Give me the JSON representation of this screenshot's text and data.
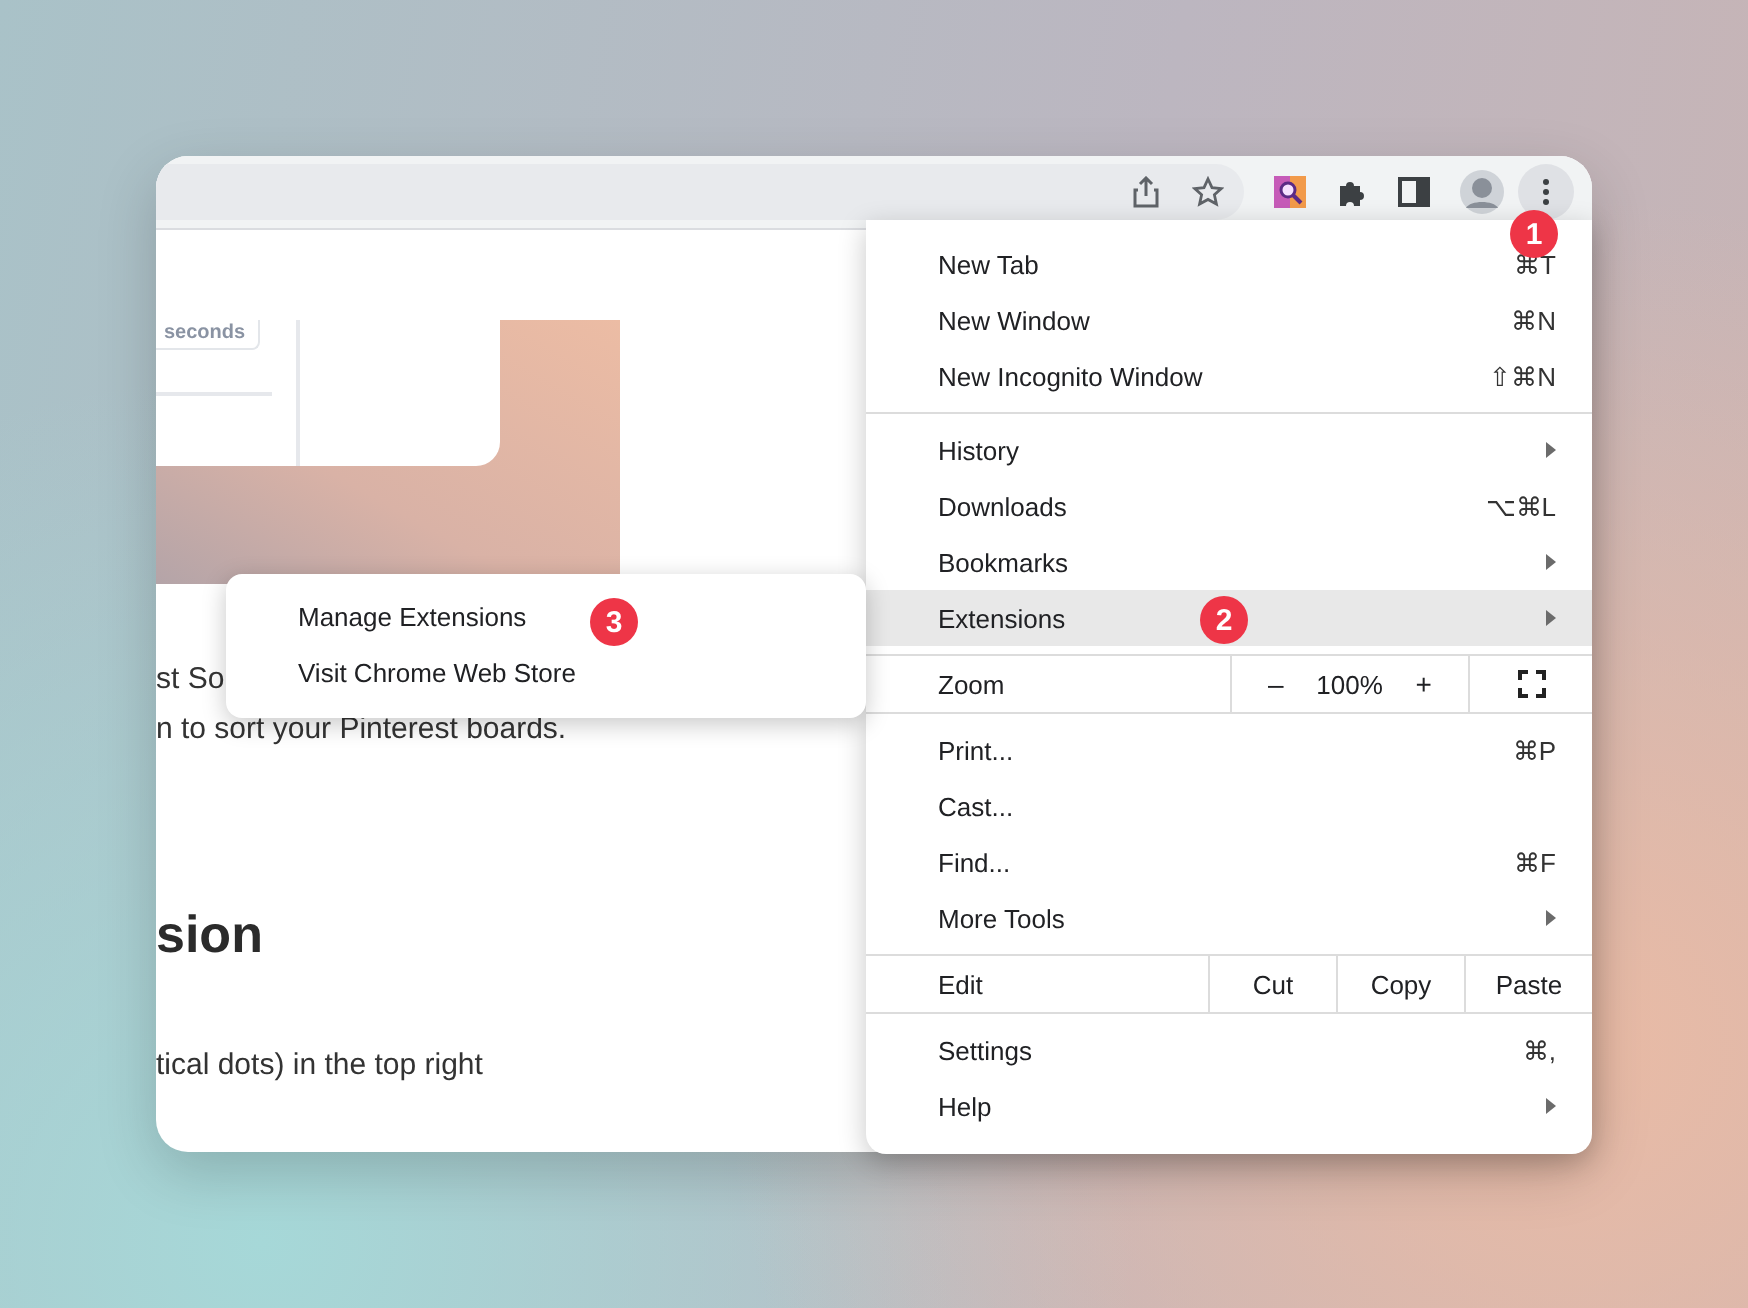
{
  "page": {
    "image": {
      "kind": "picture",
      "chip": "seconds"
    },
    "lines": [
      "st So",
      "n to sort your Pinterest boards."
    ],
    "heading": "sion",
    "text": "tical dots) in the top right"
  },
  "menu": {
    "sections": [
      {
        "kind": "items",
        "items": [
          {
            "label": "New Tab",
            "shortcut": "⌘T",
            "submenu": false,
            "selected": false
          },
          {
            "label": "New Window",
            "shortcut": "⌘N",
            "submenu": false,
            "selected": false
          },
          {
            "label": "New Incognito Window",
            "shortcut": "⇧⌘N",
            "submenu": false,
            "selected": false
          }
        ]
      },
      {
        "kind": "items",
        "items": [
          {
            "label": "History",
            "submenu": true,
            "selected": false
          },
          {
            "label": "Downloads",
            "shortcut": "⌥⌘L",
            "submenu": false,
            "selected": false
          },
          {
            "label": "Bookmarks",
            "submenu": true,
            "selected": false
          },
          {
            "label": "Extensions",
            "submenu": true,
            "selected": true
          }
        ]
      },
      {
        "kind": "zoom",
        "label": "Zoom",
        "minus": "–",
        "value": "100%",
        "plus": "+"
      },
      {
        "kind": "items",
        "items": [
          {
            "label": "Print...",
            "shortcut": "⌘P",
            "submenu": false,
            "selected": false
          },
          {
            "label": "Cast...",
            "submenu": false,
            "selected": false
          },
          {
            "label": "Find...",
            "shortcut": "⌘F",
            "submenu": false,
            "selected": false
          },
          {
            "label": "More Tools",
            "submenu": true,
            "selected": false
          }
        ]
      },
      {
        "kind": "edit",
        "label": "Edit",
        "buttons": [
          "Cut",
          "Copy",
          "Paste"
        ]
      },
      {
        "kind": "items",
        "items": [
          {
            "label": "Settings",
            "shortcut": "⌘,",
            "submenu": false,
            "selected": false
          },
          {
            "label": "Help",
            "submenu": true,
            "selected": false
          }
        ]
      }
    ]
  },
  "submenu": {
    "items": [
      {
        "label": "Manage Extensions"
      },
      {
        "label": "Visit Chrome Web Store"
      }
    ]
  },
  "badges": [
    {
      "label": "1"
    },
    {
      "label": "2"
    },
    {
      "label": "3"
    }
  ]
}
